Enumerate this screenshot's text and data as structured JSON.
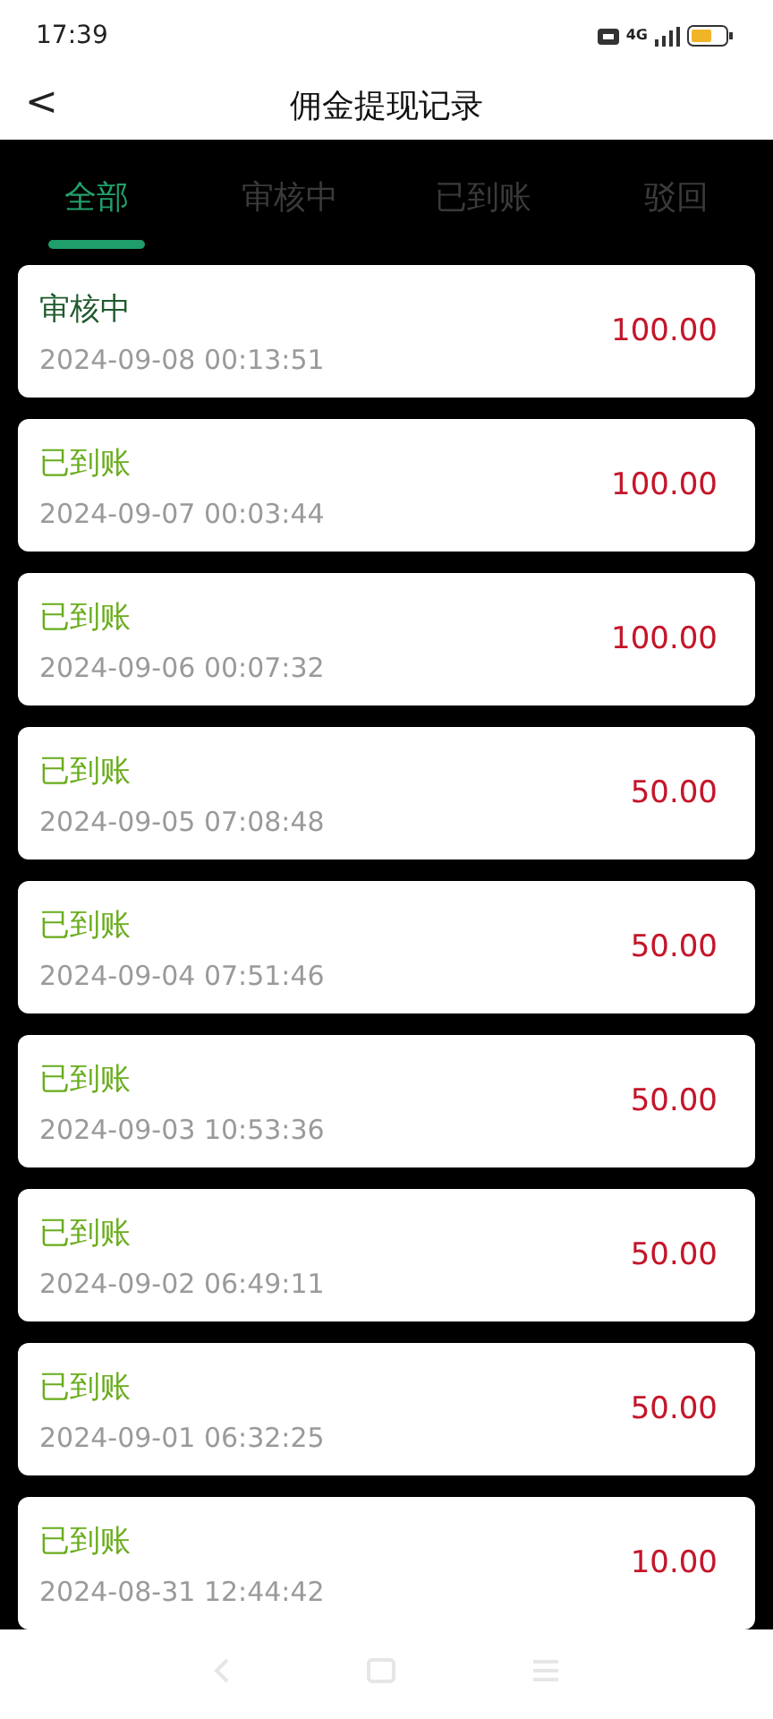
{
  "status_bar": {
    "time": "17:39",
    "network": "4G"
  },
  "header": {
    "back": "<",
    "title": "佣金提现记录"
  },
  "tabs": [
    {
      "label": "全部",
      "selected": true
    },
    {
      "label": "审核中",
      "selected": false
    },
    {
      "label": "已到账",
      "selected": false
    },
    {
      "label": "驳回",
      "selected": false
    }
  ],
  "records": [
    {
      "status": "审核中",
      "kind": "reviewing",
      "time": "2024-09-08 00:13:51",
      "amount": "100.00"
    },
    {
      "status": "已到账",
      "kind": "credited",
      "time": "2024-09-07 00:03:44",
      "amount": "100.00"
    },
    {
      "status": "已到账",
      "kind": "credited",
      "time": "2024-09-06 00:07:32",
      "amount": "100.00"
    },
    {
      "status": "已到账",
      "kind": "credited",
      "time": "2024-09-05 07:08:48",
      "amount": "50.00"
    },
    {
      "status": "已到账",
      "kind": "credited",
      "time": "2024-09-04 07:51:46",
      "amount": "50.00"
    },
    {
      "status": "已到账",
      "kind": "credited",
      "time": "2024-09-03 10:53:36",
      "amount": "50.00"
    },
    {
      "status": "已到账",
      "kind": "credited",
      "time": "2024-09-02 06:49:11",
      "amount": "50.00"
    },
    {
      "status": "已到账",
      "kind": "credited",
      "time": "2024-09-01 06:32:25",
      "amount": "50.00"
    },
    {
      "status": "已到账",
      "kind": "credited",
      "time": "2024-08-31 12:44:42",
      "amount": "10.00"
    }
  ]
}
